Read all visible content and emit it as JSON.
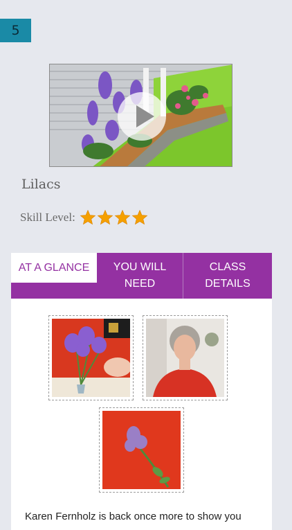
{
  "page_badge": "5",
  "video": {
    "play_icon": "play-icon"
  },
  "lesson": {
    "title": "Lilacs",
    "skill_label": "Skill Level:",
    "skill_stars": 4,
    "star_color": "#f5a000"
  },
  "tabs": [
    {
      "label_line1": "AT A GLANCE",
      "label_line2": "",
      "active": true
    },
    {
      "label_line1": "YOU WILL",
      "label_line2": "NEED",
      "active": false
    },
    {
      "label_line1": "CLASS",
      "label_line2": "DETAILS",
      "active": false
    }
  ],
  "colors": {
    "accent": "#9431a2",
    "badge": "#1a8aa6",
    "background": "#e6e8ee"
  },
  "description": "Karen Fernholz is back once more to show you"
}
